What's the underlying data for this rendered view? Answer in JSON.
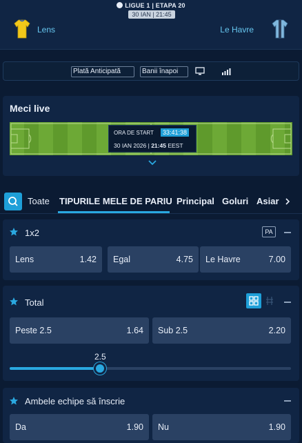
{
  "match": {
    "league": "LIGUE 1",
    "separator": "|",
    "stage": "ETAPA",
    "round": "20",
    "kickoff_short": "30 IAN | 21:45",
    "home_team": "Lens",
    "away_team": "Le Havre"
  },
  "info_bar": {
    "early_payout_label": "Plată Anticipată",
    "money_back_label": "Banii înapoi",
    "tv_icon": "tv-icon",
    "stats_icon": "stats-bars-icon"
  },
  "live": {
    "title": "Meci live",
    "start_label": "ORA DE START",
    "countdown": "33:41:38",
    "start_date": "30 IAN 2026 |",
    "start_time": "21:45",
    "timezone": "EEST"
  },
  "tabs": [
    {
      "label": "Toate"
    },
    {
      "label": "TIPURILE MELE DE PARIU"
    },
    {
      "label": "Principal"
    },
    {
      "label": "Goluri"
    },
    {
      "label": "Asiar"
    }
  ],
  "markets": {
    "m1x2": {
      "title": "1x2",
      "badge": "PA",
      "odds": [
        {
          "label": "Lens",
          "value": "1.42"
        },
        {
          "label": "Egal",
          "value": "4.75"
        },
        {
          "label": "Le Havre",
          "value": "7.00"
        }
      ]
    },
    "total": {
      "title": "Total",
      "odds": [
        {
          "label": "Peste 2.5",
          "value": "1.64"
        },
        {
          "label": "Sub 2.5",
          "value": "2.20"
        }
      ],
      "slider_value": "2.5",
      "slider_fraction": 0.32
    },
    "btts": {
      "title": "Ambele echipe să înscrie",
      "odds": [
        {
          "label": "Da",
          "value": "1.90"
        },
        {
          "label": "Nu",
          "value": "1.90"
        }
      ]
    }
  },
  "colors": {
    "background": "#0b1b33",
    "panel": "#102544",
    "odd_button": "#2a4163",
    "accent": "#1e9fd8",
    "team_name": "#67c7f0",
    "home_jersey": "#f2c81a",
    "away_jersey": "#7fb6dc"
  }
}
